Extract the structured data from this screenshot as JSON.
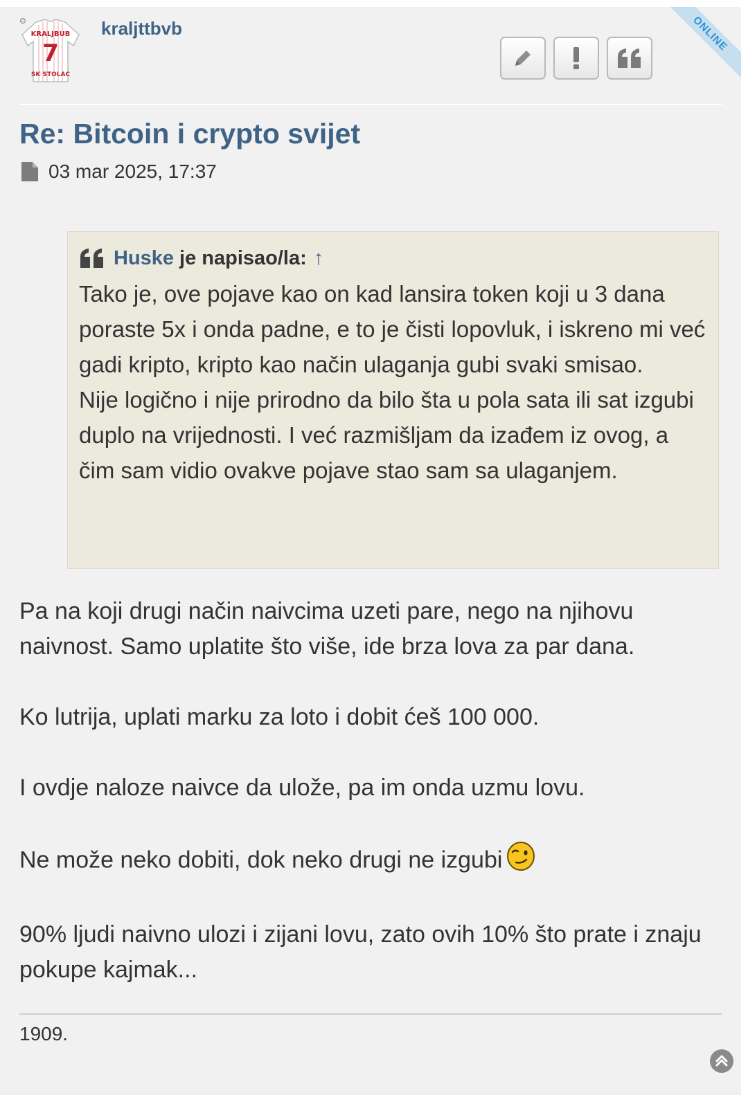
{
  "status": {
    "online_label": "ONLINE"
  },
  "author": {
    "username": "kraljttbvb",
    "avatar_text_top": "KRALJBUB",
    "avatar_number": "7",
    "avatar_text_bottom": "SK STOLAC"
  },
  "actions": [
    {
      "name": "edit-button",
      "icon": "pencil-icon"
    },
    {
      "name": "report-button",
      "icon": "exclamation-icon"
    },
    {
      "name": "quote-button",
      "icon": "quote-icon"
    }
  ],
  "post": {
    "title": "Re: Bitcoin i crypto svijet",
    "date": "03 mar 2025, 17:37",
    "quote": {
      "author": "Huske",
      "wrote_label": "je napisao/la:",
      "up_arrow": "↑",
      "paragraphs": [
        "Tako je, ove pojave kao on kad lansira token koji u 3 dana poraste 5x i onda padne, e to je čisti lopovluk, i iskreno mi već gadi kripto, kripto kao način ulaganja gubi svaki smisao.",
        "Nije logično i nije prirodno da bilo šta u pola sata ili sat izgubi duplo na vrijednosti. I već razmišljam da izađem iz ovog, a čim sam vidio ovakve pojave stao sam sa ulaganjem."
      ]
    },
    "body": [
      "Pa na koji drugi način naivcima uzeti pare, nego na njihovu naivnost. Samo uplatite što više, ide brza lova za par dana.",
      "Ko lutrija, uplati marku za loto i dobit ćeš 100 000.",
      "I ovdje naloze naivce da ulože, pa im onda uzmu lovu.",
      "Ne može neko dobiti, dok neko drugi ne izgubi",
      "90% ljudi naivno ulozi i zijani lovu, zato ovih 10% što prate i znaju pokupe kajmak..."
    ],
    "signature": "1909."
  },
  "colors": {
    "link": "#3e6386",
    "quote_bg": "#ebeadd",
    "page_bg": "#f1f1f1",
    "online": "#2b93d6"
  }
}
